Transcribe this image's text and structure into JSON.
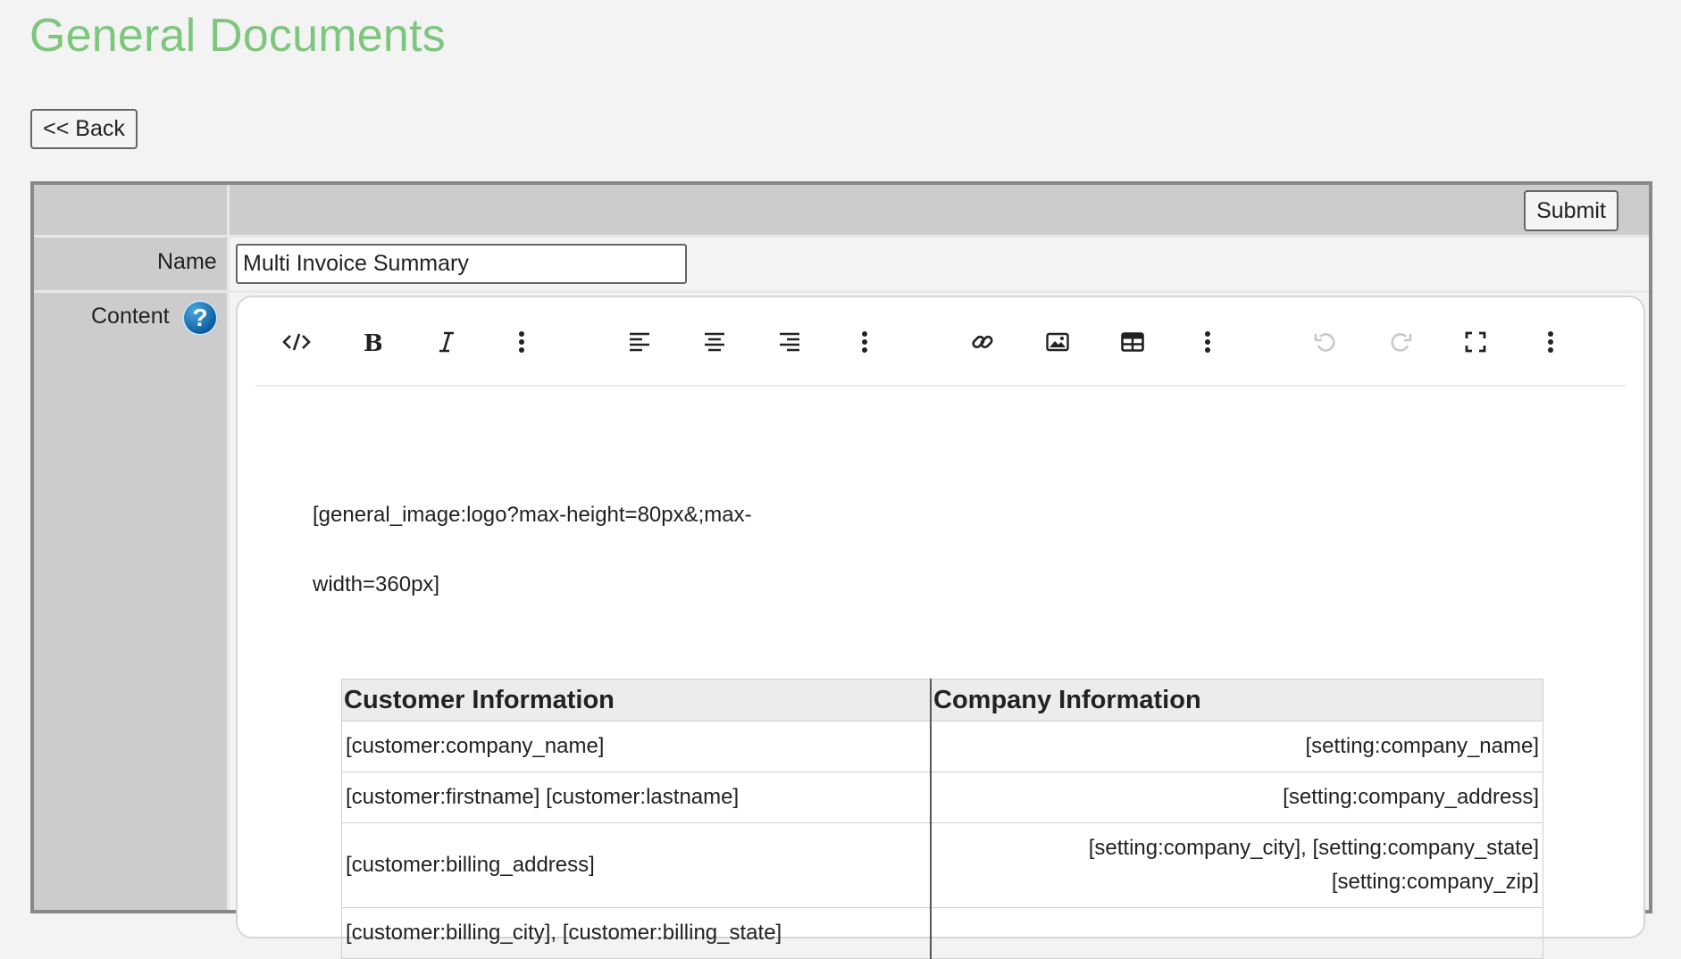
{
  "page": {
    "title": "General Documents",
    "back_label": "<< Back"
  },
  "form": {
    "submit_label": "Submit",
    "name_label": "Name",
    "name_value": "Multi Invoice Summary",
    "content_label": "Content",
    "help_glyph": "?"
  },
  "toolbar": {
    "buttons": [
      {
        "name": "source-code-icon",
        "glyph": "</>"
      },
      {
        "name": "bold-icon",
        "glyph": "B"
      },
      {
        "name": "italic-icon",
        "glyph": "I"
      },
      {
        "name": "more-text-icon",
        "glyph": "⋮"
      },
      {
        "name": "align-left-icon",
        "glyph": "align-left"
      },
      {
        "name": "align-center-icon",
        "glyph": "align-center"
      },
      {
        "name": "align-right-icon",
        "glyph": "align-right"
      },
      {
        "name": "more-paragraph-icon",
        "glyph": "⋮"
      },
      {
        "name": "link-icon",
        "glyph": "link"
      },
      {
        "name": "image-icon",
        "glyph": "image"
      },
      {
        "name": "table-icon",
        "glyph": "table"
      },
      {
        "name": "more-insert-icon",
        "glyph": "⋮"
      },
      {
        "name": "undo-icon",
        "glyph": "undo"
      },
      {
        "name": "redo-icon",
        "glyph": "redo"
      },
      {
        "name": "fullscreen-icon",
        "glyph": "fullscreen"
      },
      {
        "name": "more-misc-icon",
        "glyph": "⋮"
      }
    ]
  },
  "content": {
    "line1": "[general_image:logo?max-height=80px&;max-",
    "line2": "width=360px]",
    "table": {
      "headers": [
        "Customer Information",
        "Company Information"
      ],
      "rows": [
        [
          "[customer:company_name]",
          "[setting:company_name]"
        ],
        [
          "[customer:firstname] [customer:lastname]",
          "[setting:company_address]"
        ],
        [
          "[customer:billing_address]",
          "[setting:company_city], [setting:company_state] [setting:company_zip]"
        ],
        [
          "[customer:billing_city], [customer:billing_state]",
          ""
        ]
      ]
    }
  }
}
